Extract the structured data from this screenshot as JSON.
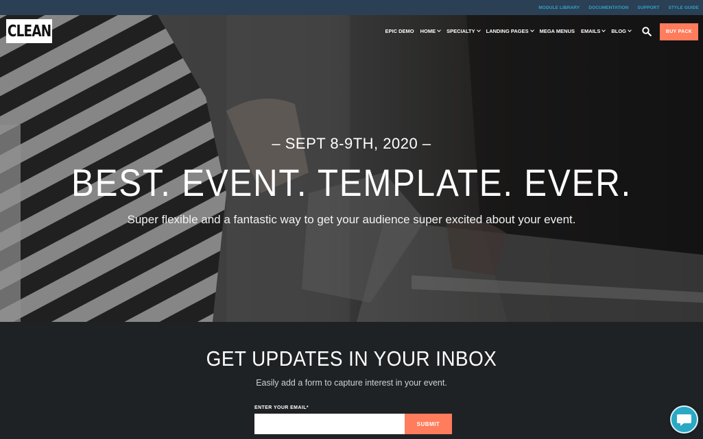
{
  "topbar": {
    "links": [
      "MODULE LIBRARY",
      "DOCUMENTATION",
      "SUPPORT",
      "STYLE GUIDE"
    ]
  },
  "nav": {
    "logo_text": "CLEAN",
    "items": [
      {
        "label": "EPIC DEMO",
        "dropdown": false
      },
      {
        "label": "HOME",
        "dropdown": true
      },
      {
        "label": "SPECIALTY",
        "dropdown": true
      },
      {
        "label": "LANDING PAGES",
        "dropdown": true
      },
      {
        "label": "MEGA MENUS",
        "dropdown": false
      },
      {
        "label": "EMAILS",
        "dropdown": true
      },
      {
        "label": "BLOG",
        "dropdown": true
      }
    ],
    "search_icon": "search-icon",
    "buy_label": "BUY PACK"
  },
  "hero": {
    "date": "– SEPT 8-9TH, 2020 –",
    "headline": "BEST. EVENT. TEMPLATE. EVER.",
    "tagline": "Super flexible and a fantastic way to get your audience super excited about your event."
  },
  "updates": {
    "title": "GET UPDATES IN YOUR INBOX",
    "subtitle": "Easily add a form to capture interest in your event.",
    "email_label": "ENTER YOUR EMAIL*",
    "email_value": "",
    "submit_label": "SUBMIT"
  },
  "colors": {
    "accent": "#ff7c5c",
    "topbar_bg": "#2b3f55",
    "topbar_link": "#2fa4c8",
    "dark_bg": "#1f2225",
    "chat": "#2aa8c5"
  },
  "chat": {
    "icon": "chat-bubble-icon"
  }
}
